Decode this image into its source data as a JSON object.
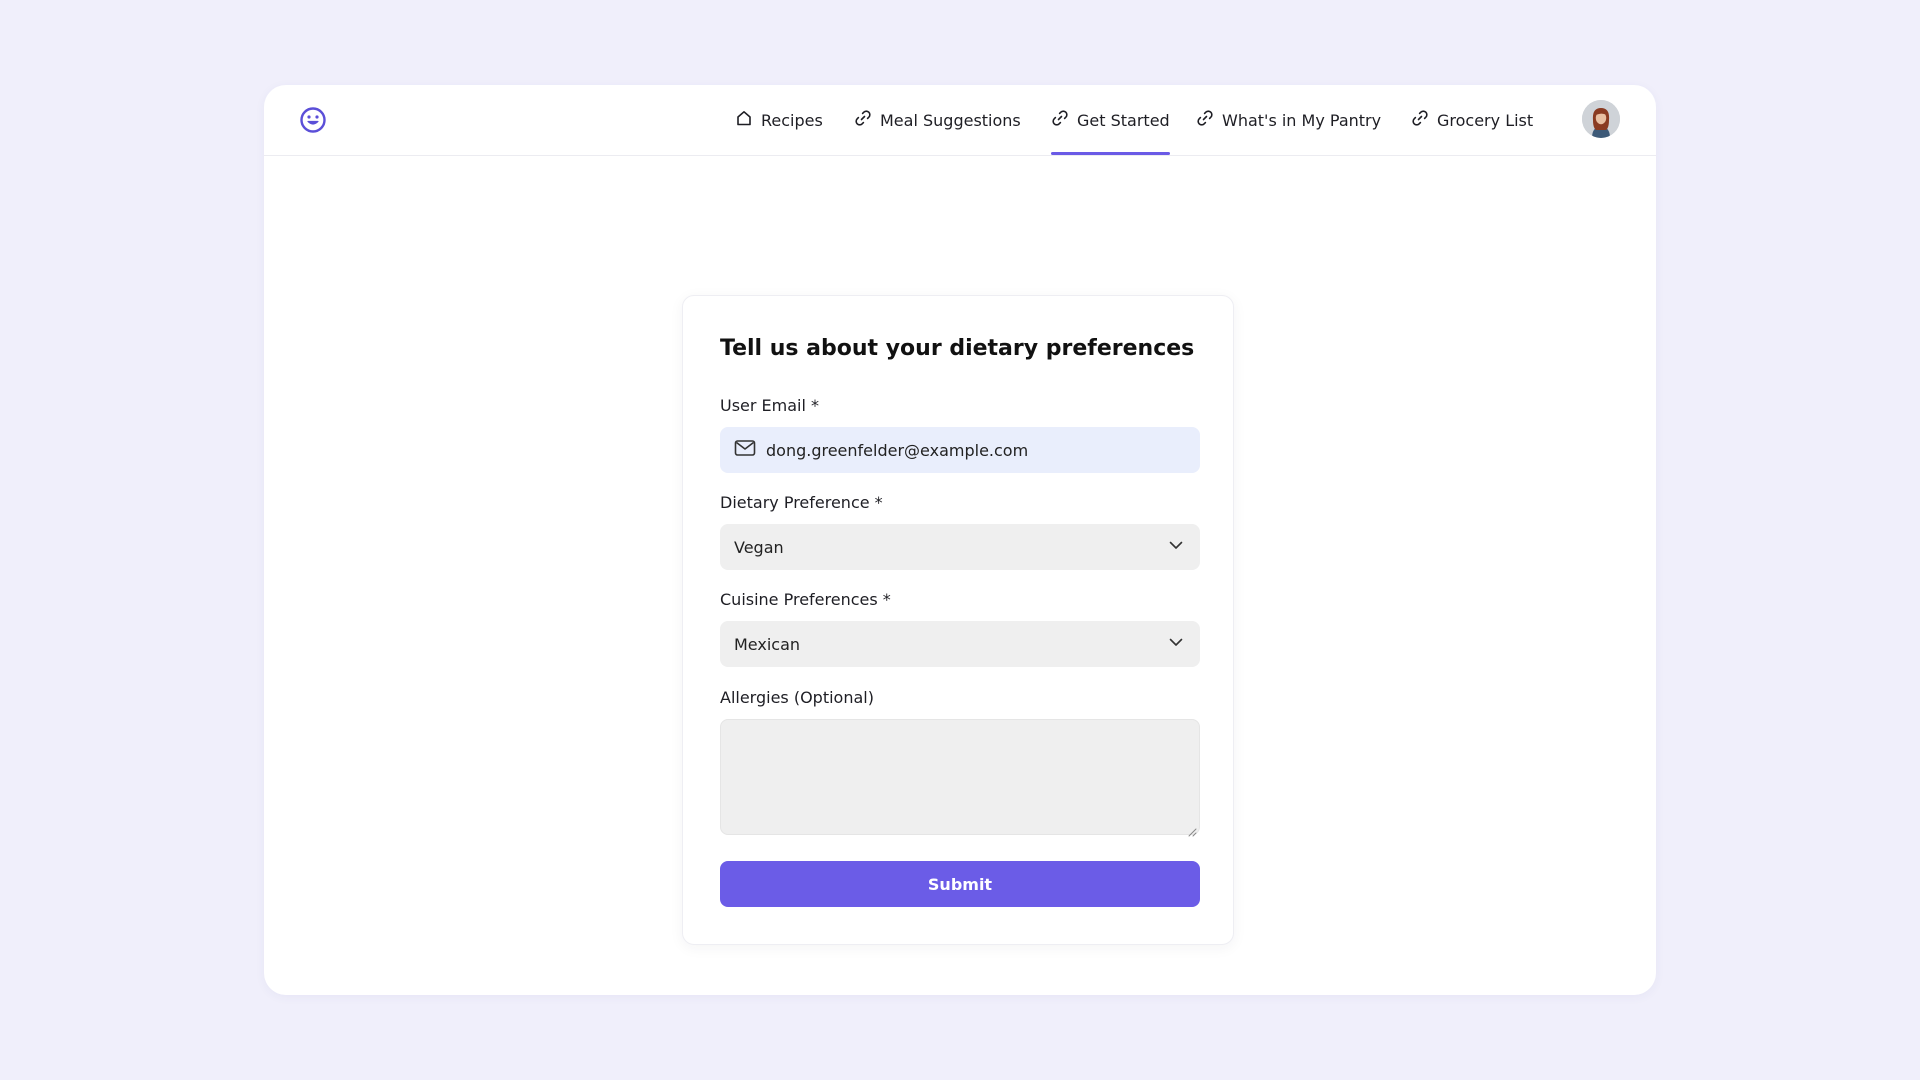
{
  "theme": {
    "accent": "#6b5ce7",
    "page_background": "#f0effb",
    "input_background": "#efefef",
    "email_background": "#e9eefc"
  },
  "header": {
    "logo_icon": "smiley-face-icon",
    "nav_links": [
      {
        "label": "Recipes",
        "icon": "home-icon",
        "active": false
      },
      {
        "label": "Meal Suggestions",
        "icon": "link-icon",
        "active": false
      },
      {
        "label": "Get Started",
        "icon": "link-icon",
        "active": true
      },
      {
        "label": "What's in My Pantry",
        "icon": "link-icon",
        "active": false
      },
      {
        "label": "Grocery List",
        "icon": "link-icon",
        "active": false
      }
    ],
    "avatar_icon": "user-avatar"
  },
  "form": {
    "title": "Tell us about your dietary preferences",
    "email": {
      "label": "User Email *",
      "value": "dong.greenfelder@example.com",
      "icon": "mail-icon"
    },
    "dietary_preference": {
      "label": "Dietary Preference *",
      "selected": "Vegan",
      "icon": "chevron-down-icon"
    },
    "cuisine_preferences": {
      "label": "Cuisine Preferences *",
      "selected": "Mexican",
      "icon": "chevron-down-icon"
    },
    "allergies": {
      "label": "Allergies (Optional)",
      "value": ""
    },
    "submit_label": "Submit"
  }
}
